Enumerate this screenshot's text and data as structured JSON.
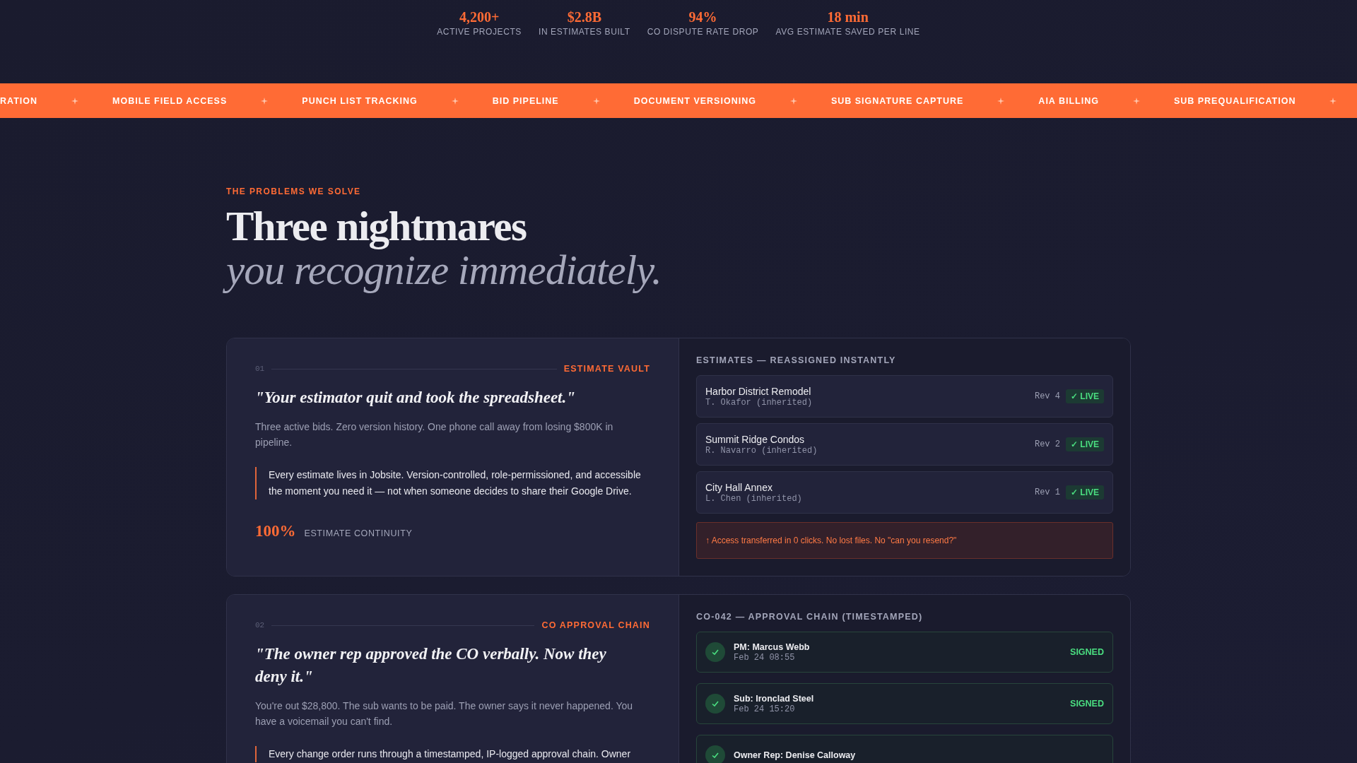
{
  "stats": [
    {
      "value": "4,200+",
      "label": "ACTIVE PROJECTS"
    },
    {
      "value": "$2.8B",
      "label": "IN ESTIMATES BUILT"
    },
    {
      "value": "94%",
      "label": "CO DISPUTE RATE DROP"
    },
    {
      "value": "18 min",
      "label": "AVG ESTIMATE SAVED PER LINE"
    }
  ],
  "ticker": [
    "RATION",
    "MOBILE FIELD ACCESS",
    "PUNCH LIST TRACKING",
    "BID PIPELINE",
    "DOCUMENT VERSIONING",
    "SUB SIGNATURE CAPTURE",
    "AIA BILLING",
    "SUB PREQUALIFICATION"
  ],
  "section": {
    "eyebrow": "THE PROBLEMS WE SOLVE",
    "title": "Three nightmares",
    "subtitle": "you recognize immediately."
  },
  "problems": [
    {
      "number": "01",
      "tag": "ESTIMATE VAULT",
      "quote": "\"Your estimator quit and took the spreadsheet.\"",
      "body": "Three active bids. Zero version history. One phone call away from losing $800K in pipeline.",
      "solution": "Every estimate lives in Jobsite. Version-controlled, role-permissioned, and accessible the moment you need it — not when someone decides to share their Google Drive.",
      "metric": {
        "value": "100%",
        "label": "ESTIMATE CONTINUITY"
      },
      "panel": {
        "kind": "estimates",
        "title": "ESTIMATES — REASSIGNED INSTANTLY",
        "rows": [
          {
            "name": "Harbor District Remodel",
            "owner": "T. Okafor (inherited)",
            "rev": "Rev 4",
            "badge": "✓ LIVE"
          },
          {
            "name": "Summit Ridge Condos",
            "owner": "R. Navarro (inherited)",
            "rev": "Rev 2",
            "badge": "✓ LIVE"
          },
          {
            "name": "City Hall Annex",
            "owner": "L. Chen (inherited)",
            "rev": "Rev 1",
            "badge": "✓ LIVE"
          }
        ],
        "note": "↑ Access transferred in 0 clicks. No lost files. No \"can you resend?\""
      }
    },
    {
      "number": "02",
      "tag": "CO APPROVAL CHAIN",
      "quote": "\"The owner rep approved the CO verbally. Now they deny it.\"",
      "body": "You're out $28,800. The sub wants to be paid. The owner says it never happened. You have a voicemail you can't find.",
      "solution": "Every change order runs through a timestamped, IP-logged approval chain. Owner",
      "panel": {
        "kind": "chain",
        "title": "CO-042 — APPROVAL CHAIN (TIMESTAMPED)",
        "steps": [
          {
            "name": "PM: Marcus Webb",
            "time": "Feb 24 08:55",
            "status": "SIGNED"
          },
          {
            "name": "Sub: Ironclad Steel",
            "time": "Feb 24 15:20",
            "status": "SIGNED"
          },
          {
            "name": "Owner Rep: Denise Calloway"
          }
        ]
      }
    }
  ]
}
